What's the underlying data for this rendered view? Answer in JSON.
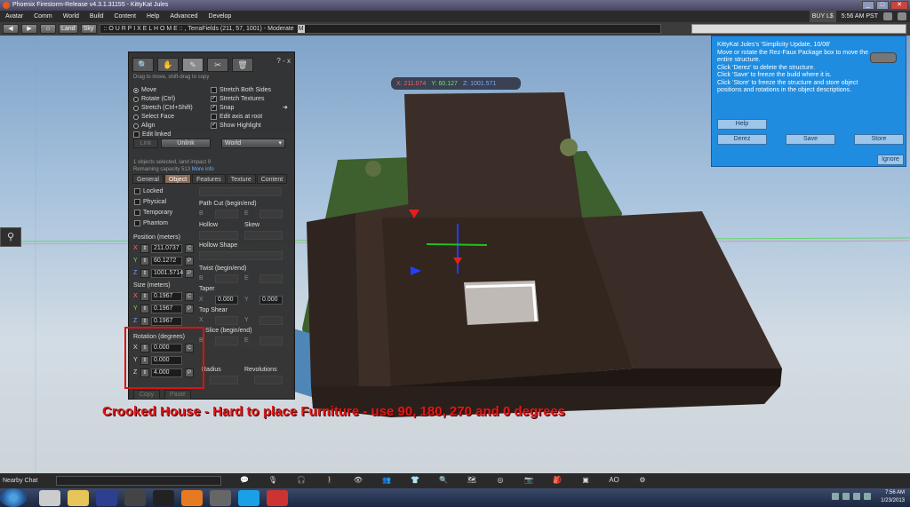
{
  "window": {
    "title": "Phoenix Firestorm-Release v4.3.1.31155 - KittyKat Jules",
    "min": "_",
    "max": "□",
    "close": "✕"
  },
  "menu": [
    "Avatar",
    "Comm",
    "World",
    "Build",
    "Content",
    "Help",
    "Advanced",
    "Develop"
  ],
  "status": {
    "balance": "L$",
    "balance_prefix": "BUY L$",
    "time": "5:56 AM PST"
  },
  "navbar": {
    "back": "◀",
    "forward": "▶",
    "home": "⌂",
    "land": "Land",
    "sky": "Sky",
    "location": ":: O U R  P I X E L  H O M E :: , TerraFields (211, 57, 1001) - Moderate",
    "rating_badge": "M"
  },
  "coords": {
    "x": "X: 211.074",
    "y": "Y: 60.127",
    "z": "Z: 1001.571"
  },
  "build": {
    "tools": [
      "🔍",
      "✋",
      "✎",
      "✂",
      "🗑"
    ],
    "help": "?",
    "minimize": "-",
    "close": "x",
    "hint": "Drag to move, shift-drag to copy",
    "edit_modes": [
      "Move",
      "Rotate (Ctrl)",
      "Stretch (Ctrl+Shift)",
      "Select Face",
      "Align",
      "Edit linked"
    ],
    "options": [
      "Stretch Both Sides",
      "Stretch Textures",
      "Snap",
      "Edit axis at root",
      "Show Highlight"
    ],
    "link": "Link",
    "unlink": "Unlink",
    "ruler": "World",
    "info_line1": "1 objects selected, land impact 9",
    "info_line2": "Remaining capacity 513",
    "more_info": "More info",
    "tabs": [
      "General",
      "Object",
      "Features",
      "Texture",
      "Content"
    ],
    "active_tab": "Object",
    "flags": [
      "Locked",
      "Physical",
      "Temporary",
      "Phantom"
    ],
    "position_label": "Position (meters)",
    "position": [
      "211.0737",
      "60.1272",
      "1001.5714"
    ],
    "size_label": "Size (meters)",
    "size": [
      "0.1967",
      "0.1967",
      "0.1967"
    ],
    "rotation_label": "Rotation (degrees)",
    "rotation": [
      "0.000",
      "0.000",
      "4.000"
    ],
    "axes": [
      "X",
      "Y",
      "Z"
    ],
    "copy": "Copy",
    "paste": "Paste",
    "c_btn": "C",
    "p_btn": "P",
    "path_cut": "Path Cut (begin/end)",
    "hollow": "Hollow",
    "skew": "Skew",
    "hollow_shape": "Hollow Shape",
    "twist": "Twist (begin/end)",
    "taper": "Taper",
    "taper_values": [
      "0.000",
      "0.000"
    ],
    "top_shear": "Top Shear",
    "slice": "Slice (begin/end)",
    "radius": "Radius",
    "revolutions": "Revolutions",
    "b": "B",
    "e": "E",
    "x": "X",
    "y": "Y"
  },
  "caption": "Crooked House - Hard to place Furniture - use 90, 180, 270 and 0 degrees",
  "dialog": {
    "lines": [
      "KittyKat Jules's 'Simplicity Update, 10/08'",
      "Move or rotate the Rez-Faux Package box to move the",
      "entire structure.",
      "Click 'Derez' to delete the structure.",
      "Click 'Save' to freeze the build where it is.",
      "Click 'Store' to freeze the structure and store object",
      "positions and rotations in the object descriptions."
    ],
    "help": "Help",
    "derez": "Derez",
    "save": "Save",
    "store": "Store",
    "ignore": "Ignore"
  },
  "bottom": {
    "nearby_chat": "Nearby Chat",
    "ao": "AO"
  },
  "taskbar": {
    "time": "7:56 AM",
    "date": "1/23/2013"
  }
}
